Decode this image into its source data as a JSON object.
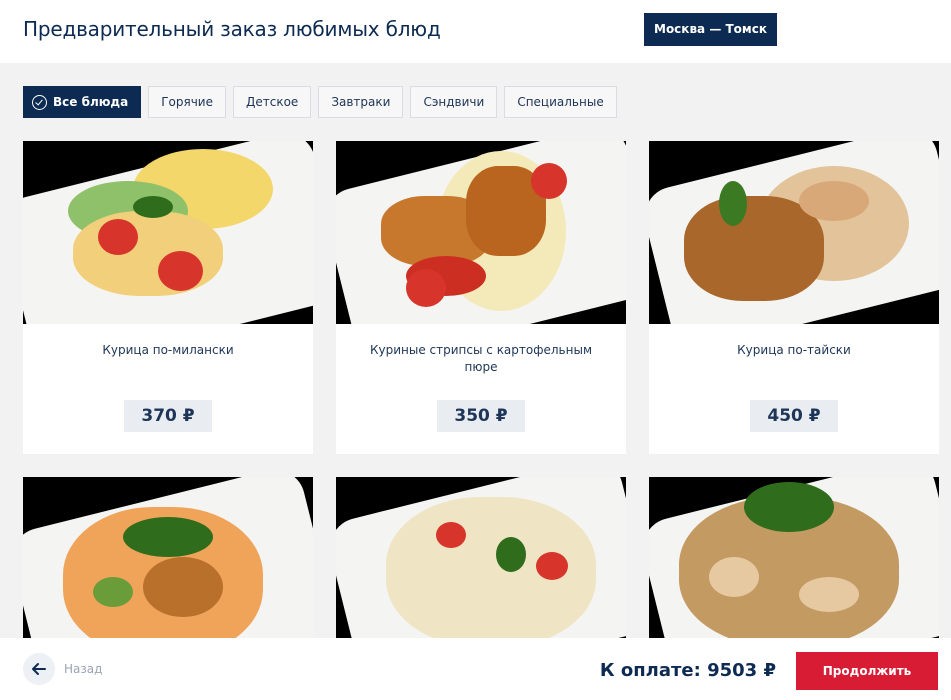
{
  "header": {
    "title": "Предварительный заказ любимых блюд",
    "route": "Москва — Томск"
  },
  "filters": [
    {
      "label": "Все блюда",
      "active": true
    },
    {
      "label": "Горячие"
    },
    {
      "label": "Детское"
    },
    {
      "label": "Завтраки"
    },
    {
      "label": "Сэндвичи"
    },
    {
      "label": "Специальные"
    }
  ],
  "dishes": [
    {
      "name": "Курица по-милански",
      "price": "370 ₽"
    },
    {
      "name": "Куриные стрипсы с картофельным пюре",
      "price": "350 ₽"
    },
    {
      "name": "Курица по-тайски",
      "price": "450 ₽"
    },
    {
      "name": ""
    },
    {
      "name": ""
    },
    {
      "name": ""
    }
  ],
  "footer": {
    "back_label": "Назад",
    "total": "К оплате:  9503 ₽",
    "continue_label": "Продолжить"
  },
  "colors": {
    "primary": "#0d2b52",
    "accent": "#d71c33",
    "background": "#f2f2f2"
  }
}
